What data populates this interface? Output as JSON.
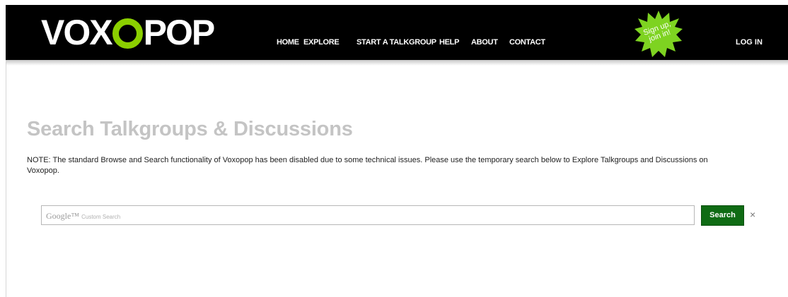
{
  "header": {
    "logo": {
      "text_left": "VOX",
      "text_mid": "O",
      "text_right": "POP",
      "accent_color": "#8bd000"
    },
    "nav": [
      {
        "label": "HOME"
      },
      {
        "label": "EXPLORE"
      },
      {
        "label": "START A TALKGROUP"
      },
      {
        "label": "HELP"
      },
      {
        "label": "ABOUT"
      },
      {
        "label": "CONTACT"
      }
    ],
    "signup_badge": {
      "line1": "Sign up,",
      "line2": "join in!",
      "color": "#7ed321"
    },
    "login_label": "LOG IN"
  },
  "main": {
    "title": "Search Talkgroups & Discussions",
    "note": "NOTE: The standard Browse and Search functionality of Voxopop has been disabled due to some technical issues. Please use the temporary search below to Explore Talkgroups and Discussions on Voxopop.",
    "search": {
      "watermark_brand": "Google™",
      "watermark_text": "Custom Search",
      "value": "",
      "button_label": "Search",
      "clear_icon": "×",
      "button_color": "#0f6b14"
    }
  }
}
